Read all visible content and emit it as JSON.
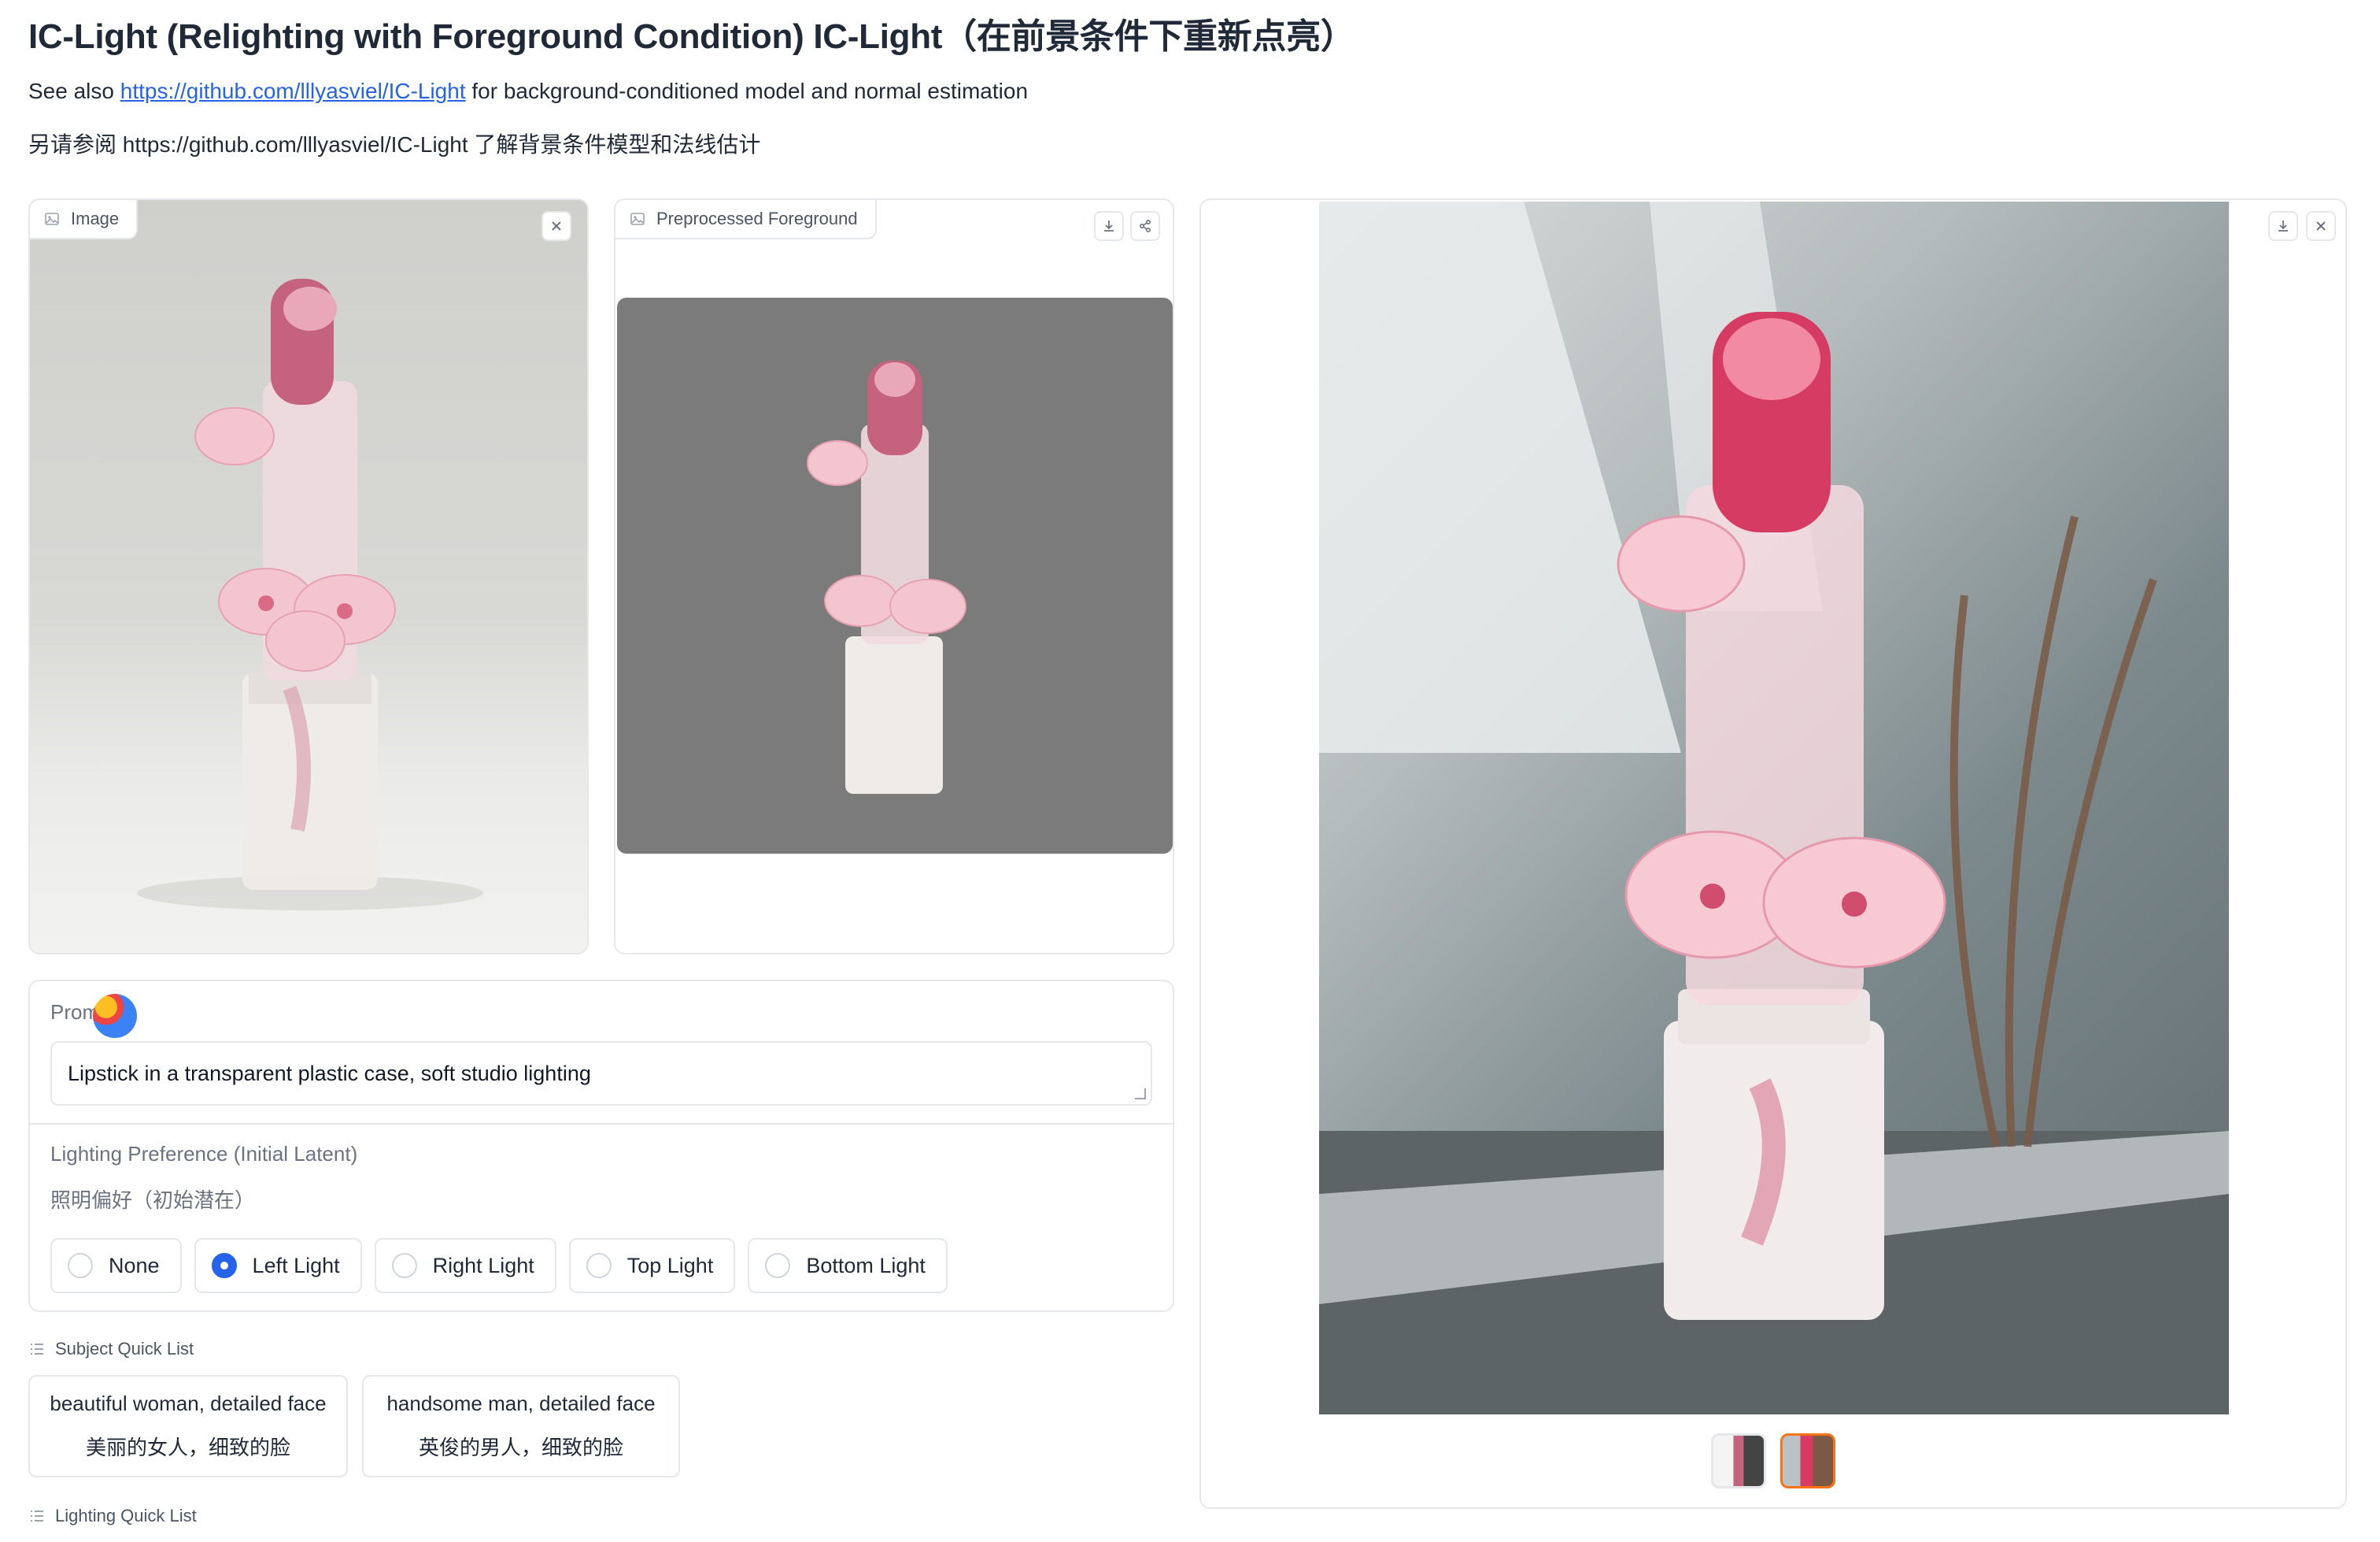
{
  "header": {
    "title": "IC-Light (Relighting with Foreground Condition) IC-Light（在前景条件下重新点亮）",
    "see_also_prefix": "See also ",
    "see_also_link": "https://github.com/lllyasviel/IC-Light",
    "see_also_suffix": " for background-conditioned model and normal estimation",
    "see_also_cn": "另请参阅 https://github.com/lllyasviel/IC-Light 了解背景条件模型和法线估计"
  },
  "image_panel": {
    "label": "Image"
  },
  "preprocessed_panel": {
    "label": "Preprocessed Foreground"
  },
  "prompt": {
    "label": "Prom",
    "value": "Lipstick in a transparent plastic case, soft studio lighting"
  },
  "lighting": {
    "label": "Lighting Preference (Initial Latent)",
    "label_cn": "照明偏好（初始潜在）",
    "options": [
      "None",
      "Left Light",
      "Right Light",
      "Top Light",
      "Bottom Light"
    ],
    "selected": "Left Light"
  },
  "subject_quick_list": {
    "title": "Subject Quick List",
    "items": [
      {
        "en": "beautiful woman, detailed face",
        "cn": "美丽的女人，细致的脸"
      },
      {
        "en": "handsome man, detailed face",
        "cn": "英俊的男人，细致的脸"
      }
    ]
  },
  "lighting_quick_list": {
    "title": "Lighting Quick List"
  },
  "result_gallery": {
    "thumbnails": 2,
    "selected_index": 1
  },
  "icons": [
    "image-icon",
    "close-icon",
    "download-icon",
    "share-icon",
    "list-icon"
  ]
}
